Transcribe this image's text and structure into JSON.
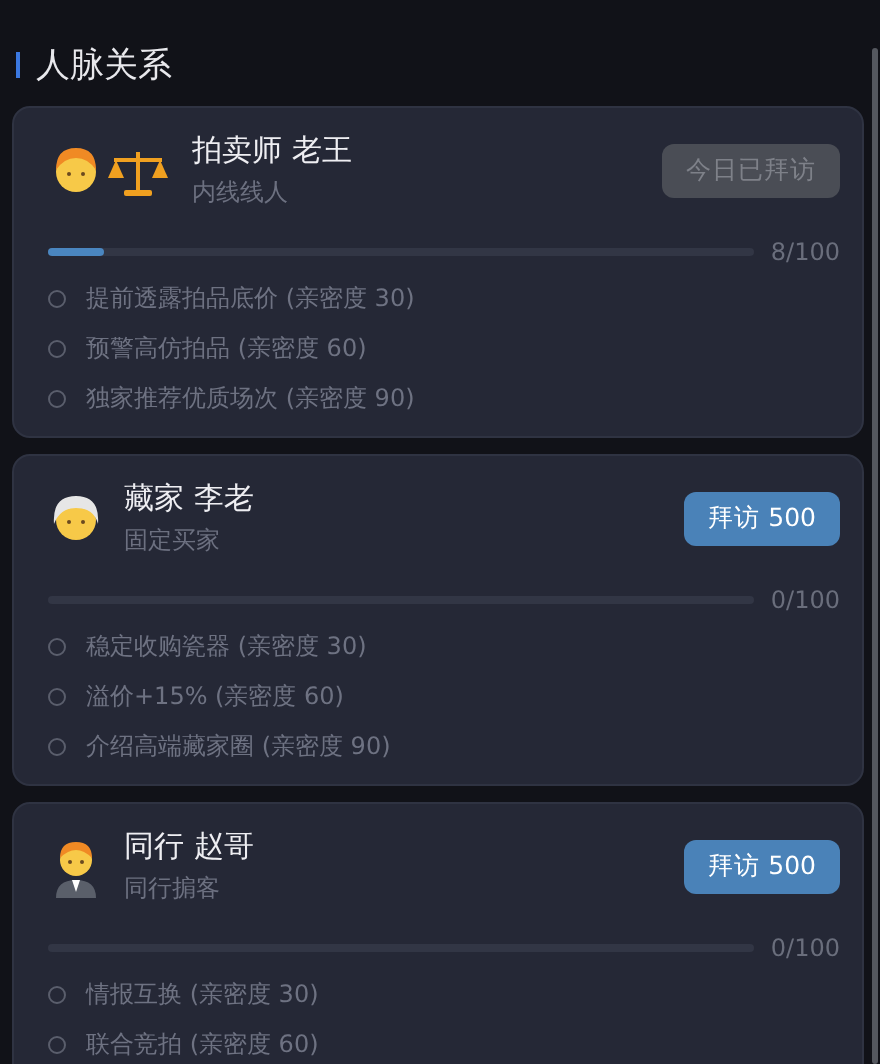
{
  "header": {
    "title": "人脉关系"
  },
  "contacts": [
    {
      "name": "拍卖师 老王",
      "role": "内线线人",
      "button": {
        "label": "今日已拜访",
        "disabled": true
      },
      "level": 0.08,
      "progress": "8/100",
      "perks": [
        {
          "label": "提前透露拍品底价 (亲密度 30)",
          "unlocked": false
        },
        {
          "label": "预警高仿拍品 (亲密度 60)",
          "unlocked": false
        },
        {
          "label": "独家推荐优质场次 (亲密度 90)",
          "unlocked": false
        }
      ]
    },
    {
      "name": "藏家 李老",
      "role": "固定买家",
      "button": {
        "label": "拜访 500",
        "disabled": false
      },
      "level": 0,
      "progress": "0/100",
      "perks": [
        {
          "label": "稳定收购瓷器 (亲密度 30)",
          "unlocked": false
        },
        {
          "label": "溢价+15% (亲密度 60)",
          "unlocked": false
        },
        {
          "label": "介绍高端藏家圈 (亲密度 90)",
          "unlocked": false
        }
      ]
    },
    {
      "name": "同行 赵哥",
      "role": "同行掮客",
      "button": {
        "label": "拜访 500",
        "disabled": false
      },
      "level": 0,
      "progress": "0/100",
      "perks": [
        {
          "label": "情报互换 (亲密度 30)",
          "unlocked": false
        },
        {
          "label": "联合竞拍 (亲密度 60)",
          "unlocked": false
        }
      ]
    }
  ]
}
